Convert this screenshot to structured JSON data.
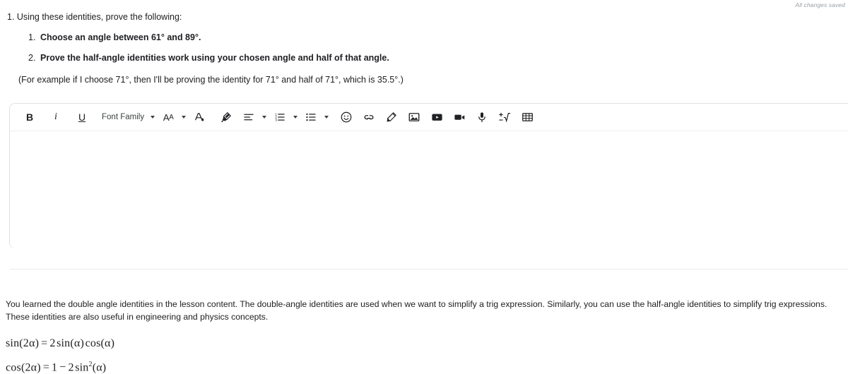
{
  "status": {
    "save_text": "All changes saved"
  },
  "prompt": {
    "lead": "1. Using these identities, prove the following:",
    "items": [
      {
        "number": "1.",
        "text": "Choose an angle between 61° and 89°."
      },
      {
        "number": "2.",
        "text": "Prove the half-angle identities work using your chosen angle and half of that angle."
      }
    ],
    "example": "(For example if I choose 71°, then I'll be proving the identity for 71° and half of 71°, which is 35.5°.)"
  },
  "editor": {
    "toolbar": {
      "bold_label": "B",
      "italic_label": "i",
      "underline_label": "U",
      "font_family_label": "Font Family",
      "font_size_label": "AA",
      "items": [
        "bold",
        "italic",
        "underline",
        "font-family",
        "font-size",
        "text-color",
        "highlighter",
        "align",
        "numbered-list",
        "bulleted-list",
        "emoji",
        "link",
        "draw",
        "image",
        "youtube",
        "video",
        "microphone",
        "equation",
        "table"
      ]
    },
    "content": "",
    "placeholder": ""
  },
  "bottom": {
    "paragraph": "You learned the double angle identities in the lesson content. The double-angle identities are used when we want to simplify a trig expression. Similarly, you can use the half-angle identities to simplify trig expressions. These identities are also useful in engineering and physics concepts.",
    "equations": [
      "sin(2α) = 2 sin(α) cos(α)",
      "cos(2α) = 1 − 2 sin²(α)"
    ]
  },
  "colors": {
    "text": "#202124",
    "muted": "#9aa0a6",
    "border": "#dfe1e5",
    "divider": "#e8eaed"
  }
}
